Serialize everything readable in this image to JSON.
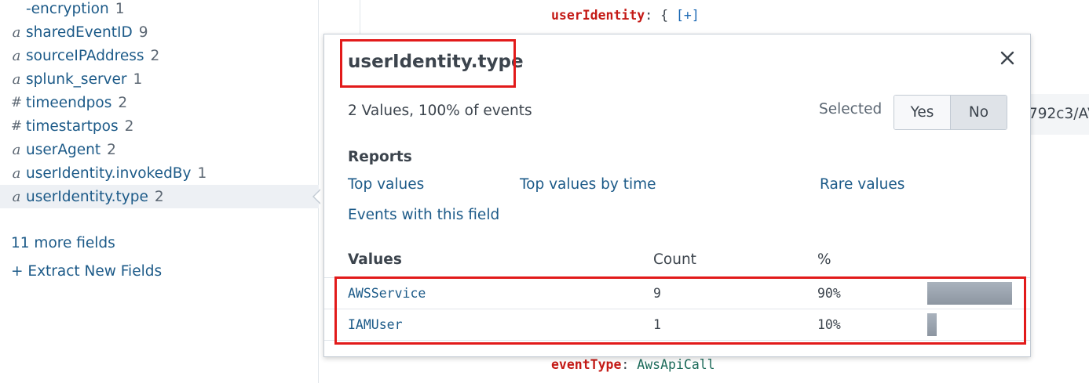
{
  "sidebar": {
    "fields": [
      {
        "type": "",
        "name": "-encryption",
        "count": "1"
      },
      {
        "type": "a",
        "name": "sharedEventID",
        "count": "9"
      },
      {
        "type": "a",
        "name": "sourceIPAddress",
        "count": "2"
      },
      {
        "type": "a",
        "name": "splunk_server",
        "count": "1"
      },
      {
        "type": "#",
        "name": "timeendpos",
        "count": "2"
      },
      {
        "type": "#",
        "name": "timestartpos",
        "count": "2"
      },
      {
        "type": "a",
        "name": "userAgent",
        "count": "2"
      },
      {
        "type": "a",
        "name": "userIdentity.invokedBy",
        "count": "1"
      },
      {
        "type": "a",
        "name": "userIdentity.type",
        "count": "2"
      }
    ],
    "more_fields": "11 more fields",
    "extract_fields": "+ Extract New Fields"
  },
  "event": {
    "top_key": "userIdentity",
    "top_sep": ": {",
    "top_expand": "[+]",
    "bottom_key": "eventType",
    "bottom_sep": ":",
    "bottom_value": "AwsApiCall",
    "cut_text": "792c3/AV"
  },
  "popover": {
    "title": "userIdentity.type",
    "close_icon": "close-icon",
    "summary": "2 Values, 100% of events",
    "selected_label": "Selected",
    "selected_options": [
      "Yes",
      "No"
    ],
    "selected_value": "No",
    "reports_label": "Reports",
    "reports": {
      "top_values": "Top values",
      "top_values_by_time": "Top values by time",
      "rare_values": "Rare values",
      "events_with_field": "Events with this field"
    },
    "table": {
      "headers": {
        "values": "Values",
        "count": "Count",
        "percent": "%"
      },
      "rows": [
        {
          "value": "AWSService",
          "count": "9",
          "percent": "90%",
          "fraction": 0.9
        },
        {
          "value": "IAMUser",
          "count": "1",
          "percent": "10%",
          "fraction": 0.1
        }
      ]
    }
  },
  "colors": {
    "highlight": "#e21a1a",
    "link": "#1c5a88",
    "key": "#c41a16"
  }
}
